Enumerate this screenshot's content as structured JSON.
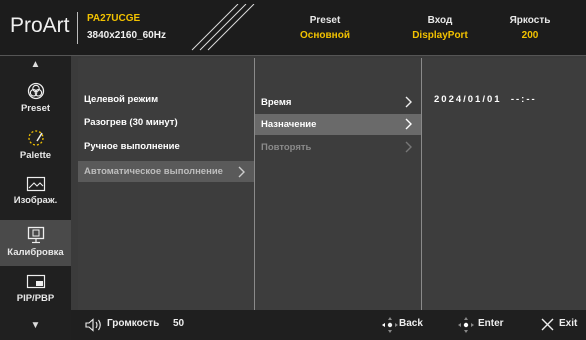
{
  "header": {
    "brand": "ProArt",
    "model": "PA27UCGE",
    "resolution": "3840x2160_60Hz",
    "preset_label": "Preset",
    "preset_value": "Основной",
    "input_label": "Вход",
    "input_value": "DisplayPort",
    "brightness_label": "Яркость",
    "brightness_value": "200"
  },
  "sidebar": {
    "items": [
      {
        "label": "Preset",
        "icon": "preset-icon"
      },
      {
        "label": "Palette",
        "icon": "palette-icon"
      },
      {
        "label": "Изображ.",
        "icon": "image-icon"
      },
      {
        "label": "Калибровка",
        "icon": "calibration-icon"
      },
      {
        "label": "PIP/PBP",
        "icon": "pip-icon"
      }
    ]
  },
  "menu_level1": [
    "Целевой режим",
    "Разогрев (30 минут)",
    "Ручное выполнение",
    "Автоматическое выполнение"
  ],
  "menu_level2": [
    "Время",
    "Назначение",
    "Повторять"
  ],
  "detail": {
    "time_value": "2024/01/01  --:--"
  },
  "footer": {
    "volume_label": "Громкость",
    "volume_value": "50",
    "back_label": "Back",
    "enter_label": "Enter",
    "exit_label": "Exit"
  },
  "colors": {
    "accent": "#f2c200",
    "selected_row": "#6a6a6a",
    "header_bg": "#1c1c1c"
  }
}
